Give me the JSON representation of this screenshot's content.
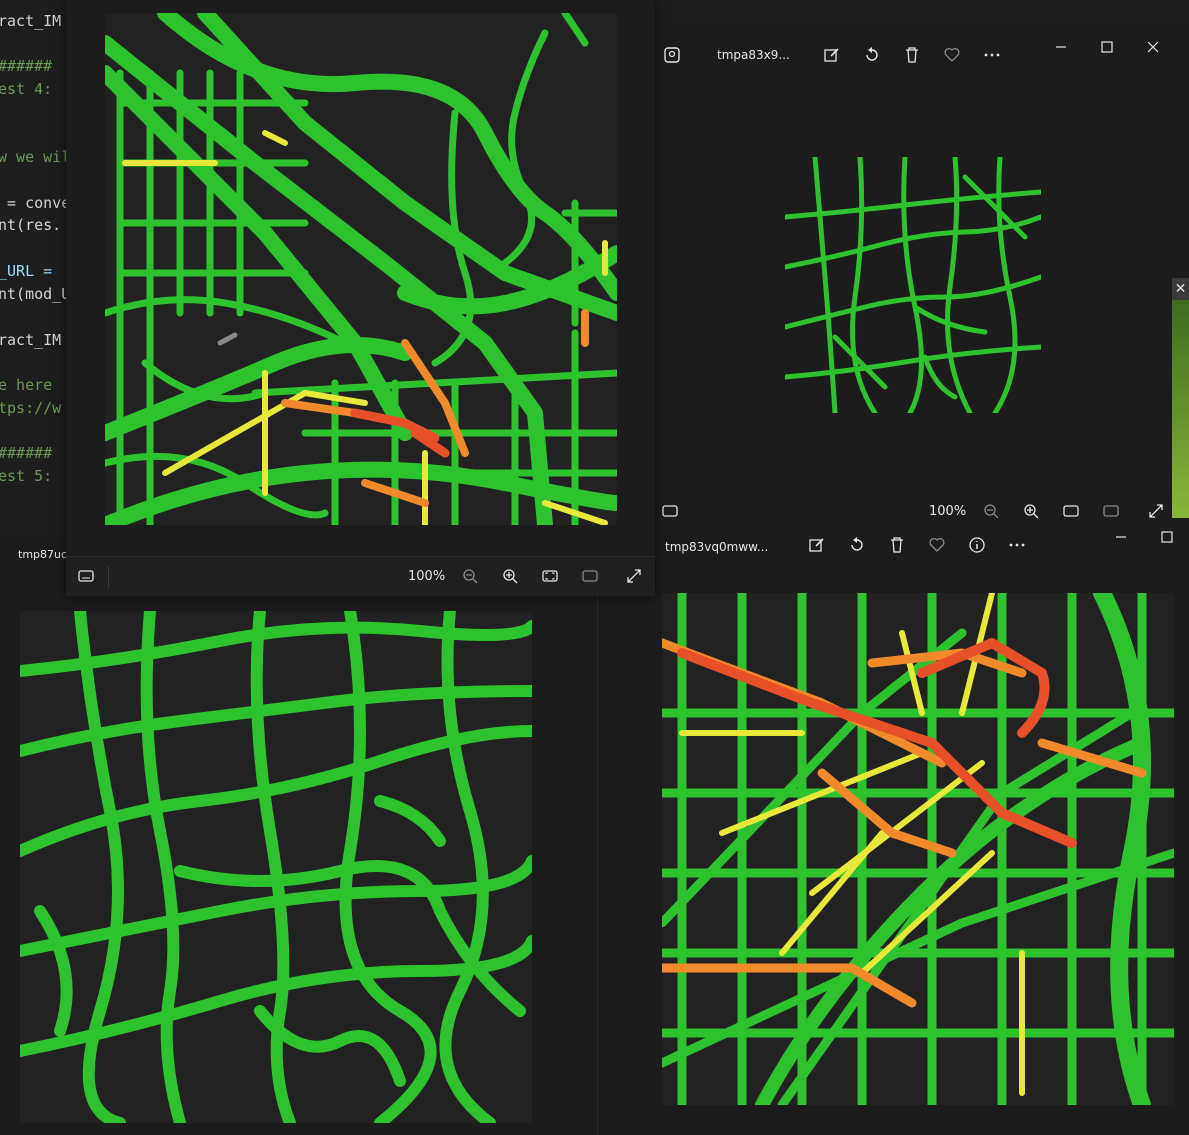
{
  "editor": {
    "lines": [
      "ract_IM",
      "######",
      "est 4:",
      "w we wil",
      " = conve",
      "nt(res.",
      "_URL = ",
      "nt(mod_U",
      "ract_IM",
      "e here ",
      "tps://w",
      "######",
      "est 5:"
    ]
  },
  "windows": {
    "top_left": {
      "zoom": "100%"
    },
    "top_right": {
      "filename": "tmpa83x9...",
      "zoom": "100%"
    },
    "bottom_left": {
      "filename": "tmp87uc"
    },
    "bottom_right": {
      "filename": "tmp83vq0mww..."
    }
  },
  "icons": {
    "edit": "edit-image-icon",
    "rotate": "rotate-icon",
    "delete": "delete-icon",
    "favorite": "heart-icon",
    "info": "info-icon",
    "more": "more-options-icon",
    "minimize": "minimize-icon",
    "maximize": "maximize-icon",
    "close": "close-icon",
    "filmstrip": "filmstrip-icon",
    "zoom_out": "zoom-out-icon",
    "zoom_in": "zoom-in-icon",
    "fit": "fit-to-window-icon",
    "actual_size": "actual-size-icon",
    "fullscreen": "fullscreen-icon"
  },
  "colors": {
    "road_green": "#2ec22e",
    "road_yellow": "#e8e83a",
    "road_orange": "#f08a2a",
    "road_red": "#e8502a",
    "background": "#222222"
  }
}
